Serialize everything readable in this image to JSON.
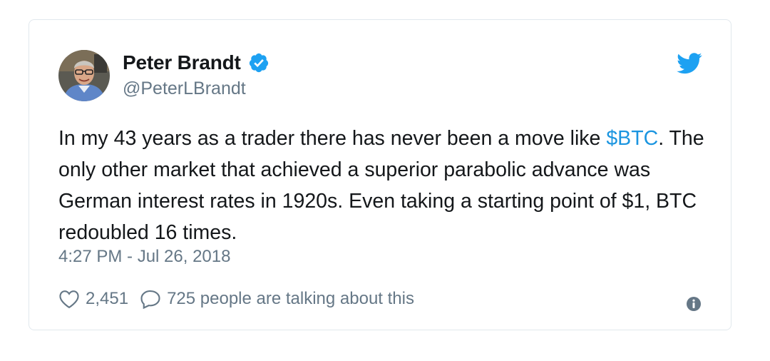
{
  "tweet": {
    "author": {
      "display_name": "Peter Brandt",
      "handle": "@PeterLBrandt",
      "verified": true
    },
    "text_before": "In my 43 years as a trader there has never been a move like ",
    "cashtag": "$BTC",
    "text_after": ". The only other market that achieved a superior parabolic advance was German interest rates in 1920s. Even taking a starting point of $1, BTC redoubled 16 times.",
    "timestamp": "4:27 PM - Jul 26, 2018",
    "likes": "2,451",
    "talking": "725 people are talking about this"
  },
  "icons": {
    "verified": "verified-badge-icon",
    "twitter": "twitter-bird-icon",
    "like": "heart-icon",
    "reply": "speech-bubble-icon",
    "info": "info-icon"
  },
  "colors": {
    "brand_blue": "#1da1f2",
    "link_blue": "#1b95e0",
    "text": "#14171a",
    "muted": "#657786",
    "border": "#e1e8ed"
  }
}
